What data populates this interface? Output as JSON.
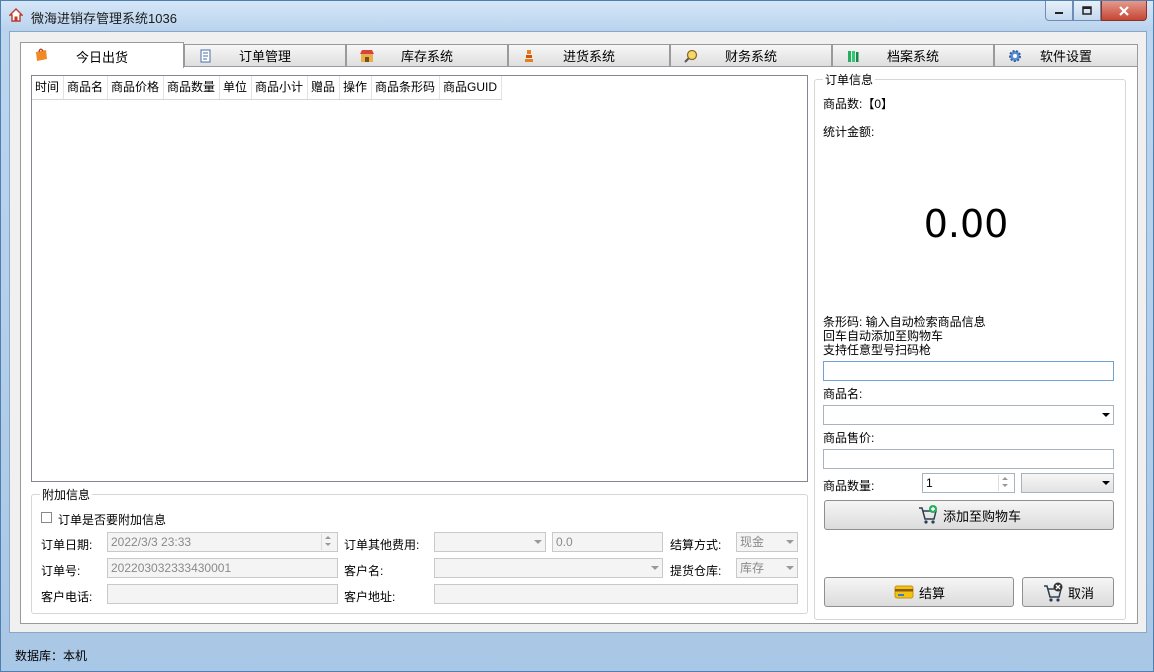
{
  "window": {
    "title": "微海进销存管理系统1036"
  },
  "tabs": [
    {
      "label": "今日出货",
      "icon": "shopping-bag-icon",
      "active": true
    },
    {
      "label": "订单管理",
      "icon": "document-icon"
    },
    {
      "label": "库存系统",
      "icon": "store-icon"
    },
    {
      "label": "进货系统",
      "icon": "stack-icon"
    },
    {
      "label": "财务系统",
      "icon": "magnifier-icon"
    },
    {
      "label": "档案系统",
      "icon": "books-icon"
    },
    {
      "label": "软件设置",
      "icon": "gear-icon"
    }
  ],
  "grid": {
    "columns": [
      "时间",
      "商品名",
      "商品价格",
      "商品数量",
      "单位",
      "商品小计",
      "赠品",
      "操作",
      "商品条形码",
      "商品GUID"
    ]
  },
  "extra": {
    "title": "附加信息",
    "attach_checkbox": "订单是否要附加信息",
    "date_label": "订单日期:",
    "date_value": "2022/3/3 23:33",
    "fee_label": "订单其他费用:",
    "fee_amount": "0.0",
    "payment_label": "结算方式:",
    "payment_value": "现金",
    "order_no_label": "订单号:",
    "order_no_value": "202203032333430001",
    "customer_label": "客户名:",
    "warehouse_label": "提货仓库:",
    "warehouse_value": "库存",
    "phone_label": "客户电话:",
    "address_label": "客户地址:"
  },
  "order": {
    "title": "订单信息",
    "count_label": "商品数:【0】",
    "total_label": "统计金额:",
    "total_value": "0.00",
    "barcode_hint_1": "条形码: 输入自动检索商品信息",
    "barcode_hint_2": "回车自动添加至购物车",
    "barcode_hint_3": "支持任意型号扫码枪",
    "name_label": "商品名:",
    "price_label": "商品售价:",
    "qty_label": "商品数量:",
    "qty_value": "1",
    "add_cart": "添加至购物车",
    "checkout": "结算",
    "cancel": "取消"
  },
  "status": {
    "text": "数据库：本机"
  },
  "colors": {
    "accent": "#1f6fd0",
    "title_bg": "#b9d3ee"
  }
}
